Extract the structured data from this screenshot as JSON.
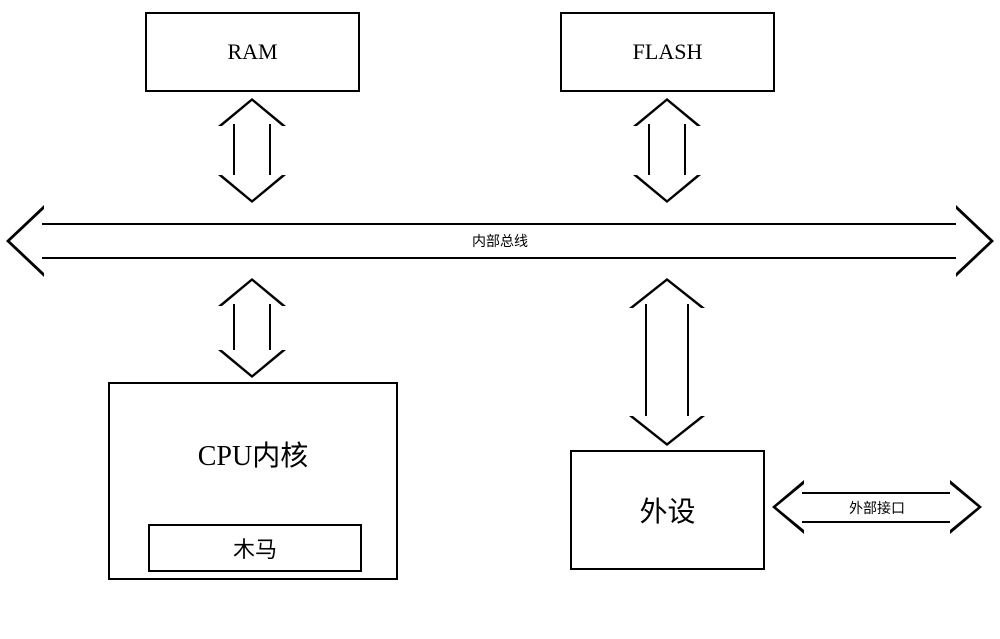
{
  "blocks": {
    "ram": "RAM",
    "flash": "FLASH",
    "cpu_core": "CPU内核",
    "trojan": "木马",
    "peripheral": "外设"
  },
  "bus": {
    "internal": "内部总线",
    "external_interface": "外部接口"
  }
}
